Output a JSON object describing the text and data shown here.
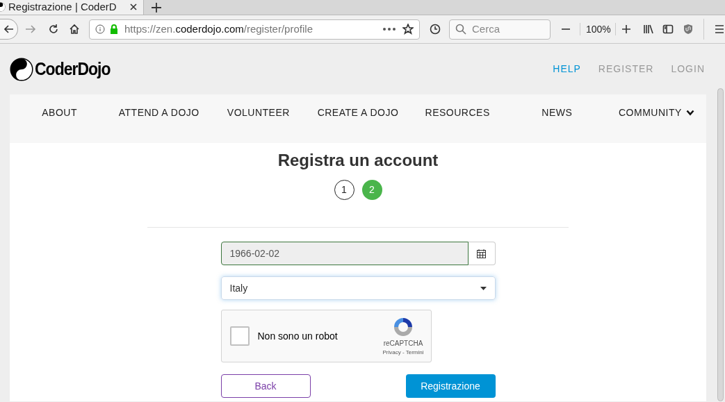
{
  "browser": {
    "tab_title": "Registrazione | CoderD",
    "url": {
      "prefix": "https://zen.",
      "domain": "coderdojo.com",
      "path": "/register/profile"
    },
    "search_placeholder": "Cerca",
    "zoom": "100%"
  },
  "site": {
    "logo": "CoderDojo",
    "top_links": [
      {
        "label": "HELP",
        "selected": true
      },
      {
        "label": "REGISTER",
        "selected": false
      },
      {
        "label": "LOGIN",
        "selected": false
      }
    ],
    "nav": [
      {
        "label": "ABOUT",
        "has_menu": false
      },
      {
        "label": "ATTEND A DOJO",
        "has_menu": false
      },
      {
        "label": "VOLUNTEER",
        "has_menu": false
      },
      {
        "label": "CREATE A DOJO",
        "has_menu": false
      },
      {
        "label": "RESOURCES",
        "has_menu": false
      },
      {
        "label": "NEWS",
        "has_menu": false
      },
      {
        "label": "COMMUNITY",
        "has_menu": true
      }
    ]
  },
  "form": {
    "title": "Registra un account",
    "steps": [
      {
        "label": "1",
        "selected": false
      },
      {
        "label": "2",
        "selected": true
      }
    ],
    "birth_date": "1966-02-02",
    "country": "Italy",
    "captcha": {
      "label": "Non sono un robot",
      "checked": false,
      "brand": "reCAPTCHA",
      "links": "Privacy - Termini"
    },
    "back_button": "Back",
    "submit_button": "Registrazione"
  }
}
